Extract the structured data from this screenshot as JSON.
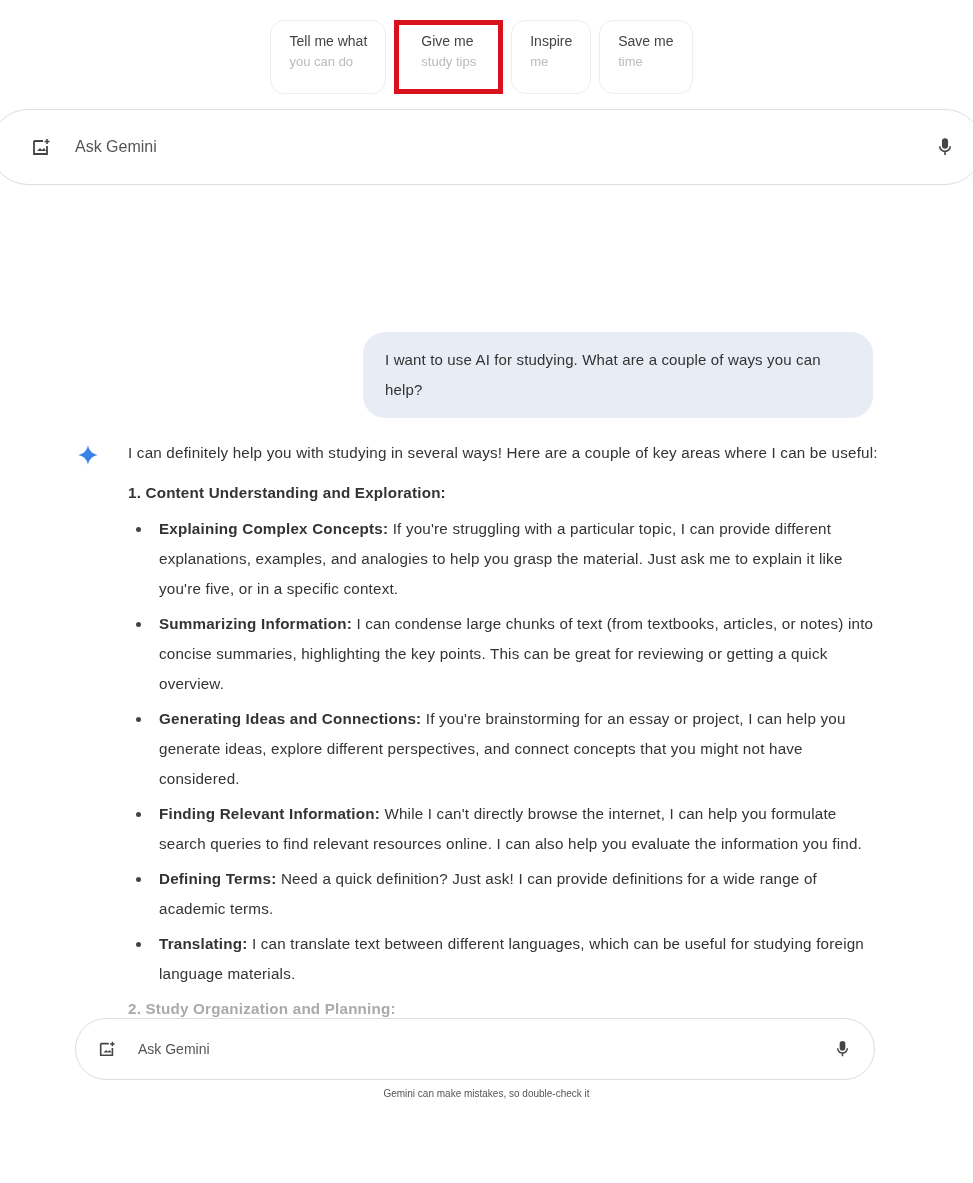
{
  "suggestions": [
    {
      "title": "Tell me what",
      "subtitle": "you can do",
      "highlighted": false
    },
    {
      "title": "Give me",
      "subtitle": "study tips",
      "highlighted": true
    },
    {
      "title": "Inspire",
      "subtitle": "me",
      "highlighted": false
    },
    {
      "title": "Save me",
      "subtitle": "time",
      "highlighted": false
    }
  ],
  "top_input": {
    "placeholder": "Ask Gemini"
  },
  "user_message": "I want to use AI for studying. What are a couple of ways you can help?",
  "response": {
    "intro": "I can definitely help you with studying in several ways! Here are a couple of key areas where I can be useful:",
    "sections": [
      {
        "heading": "1. Content Understanding and Exploration:",
        "faded": false,
        "items": [
          "**Explaining Complex Concepts:** If you're struggling with a particular topic, I can provide different explanations, examples, and analogies to help you grasp the material. Just ask me to explain it like you're five, or in a specific context.",
          "**Summarizing Information:** I can condense large chunks of text (from textbooks, articles, or notes) into concise summaries, highlighting the key points. This can be great for reviewing or getting a quick overview.",
          "**Generating Ideas and Connections:** If you're brainstorming for an essay or project, I can help you generate ideas, explore different perspectives, and connect concepts that you might not have considered.",
          "**Finding Relevant Information:** While I can't directly browse the internet, I can help you formulate search queries to find relevant resources online. I can also help you evaluate the information you find.",
          "**Defining Terms:** Need a quick definition? Just ask! I can provide definitions for a wide range of academic terms.",
          "**Translating:** I can translate text between different languages, which can be useful for studying foreign language materials."
        ]
      },
      {
        "heading": "2. Study Organization and Planning:",
        "faded": true
      }
    ]
  },
  "bottom_input": {
    "placeholder": "Ask Gemini"
  },
  "disclaimer": "Gemini can make mistakes, so double-check it"
}
